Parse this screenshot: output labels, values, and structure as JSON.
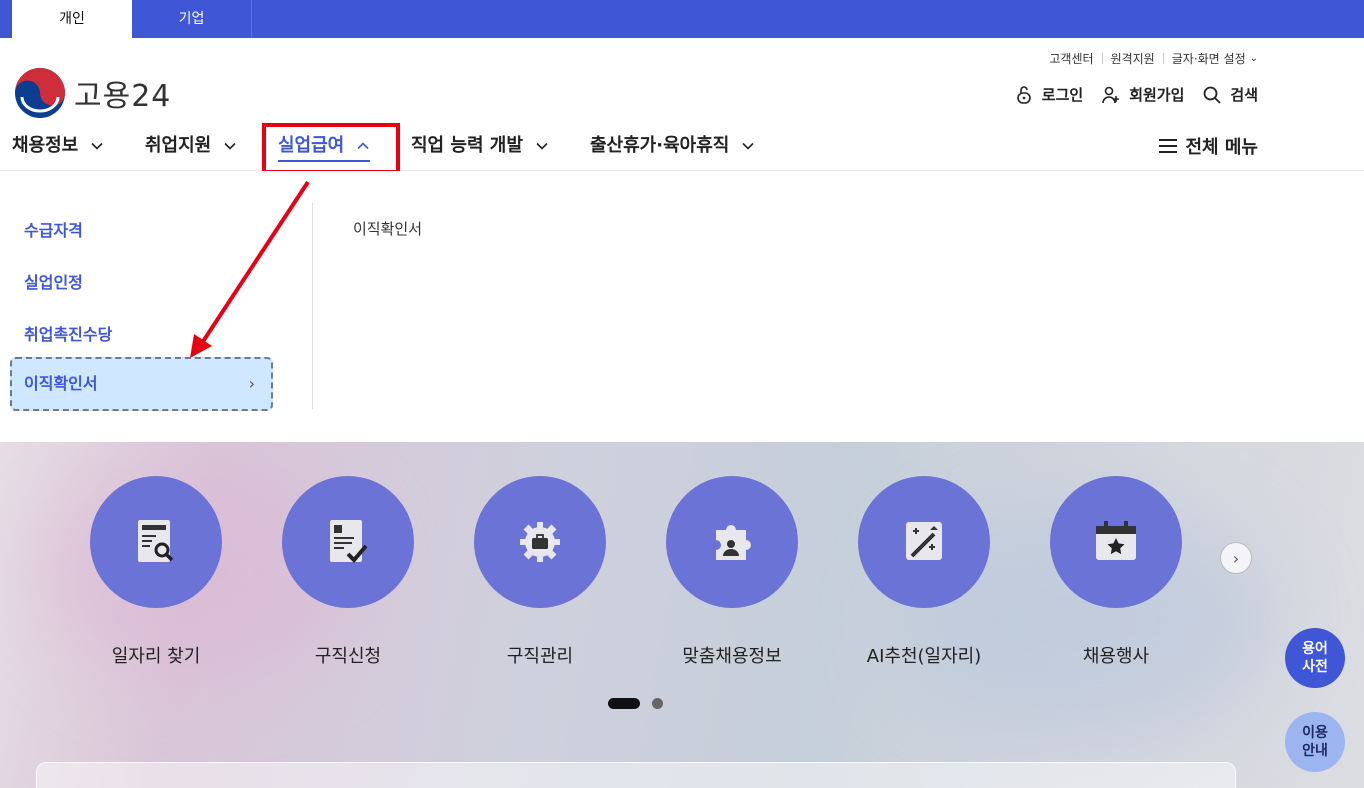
{
  "top_tabs": [
    "개인",
    "기업"
  ],
  "util_links": [
    "고객센터",
    "원격지원",
    "글자·화면 설정"
  ],
  "logo": {
    "text": "고용24"
  },
  "member": {
    "login": "로그인",
    "signup": "회원가입",
    "search": "검색"
  },
  "gnb": {
    "items": [
      "채용정보",
      "취업지원",
      "실업급여",
      "직업 능력 개발",
      "출산휴가·육아휴직"
    ],
    "active_index": 2,
    "all_menu": "전체 메뉴"
  },
  "submenu": {
    "items": [
      "수급자격",
      "실업인정",
      "취업촉진수당",
      "이직확인서"
    ],
    "selected_index": 3,
    "depth3": [
      "이직확인서"
    ]
  },
  "quick_menu": {
    "items": [
      "일자리 찾기",
      "구직신청",
      "구직관리",
      "맞춤채용정보",
      "AI추천(일자리)",
      "채용행사"
    ],
    "icons": [
      "document-search-icon",
      "document-check-icon",
      "gear-briefcase-icon",
      "puzzle-person-icon",
      "magic-wand-icon",
      "calendar-star-icon"
    ],
    "page_count": 2,
    "current_page": 1
  },
  "floating": {
    "glossary": [
      "용어",
      "사전"
    ],
    "guide": [
      "이용",
      "안내"
    ]
  },
  "colors": {
    "brand": "#3f57d6",
    "quick_circle": "#6b73d6",
    "annotation": "#e60012",
    "selected_bg": "#cfe8ff"
  }
}
